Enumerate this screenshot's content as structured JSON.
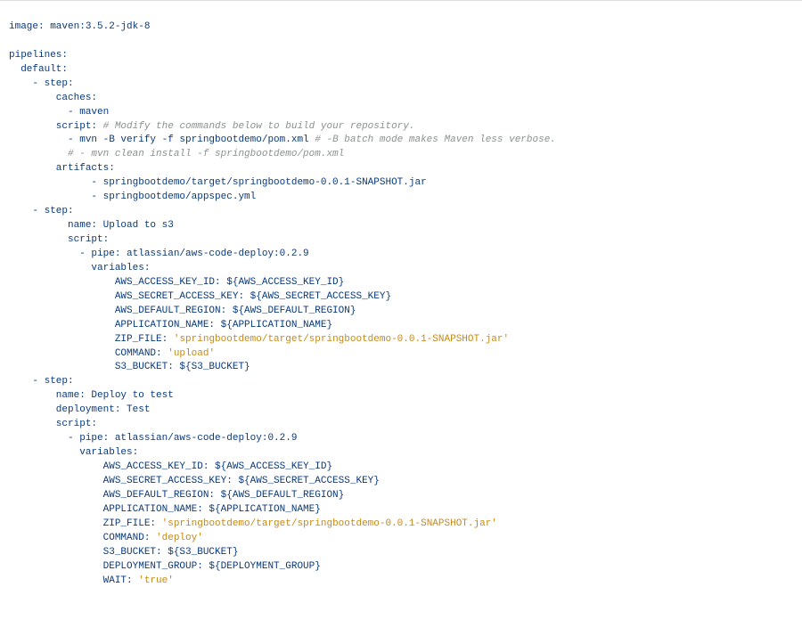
{
  "l1": "image: maven:3.5.2-jdk-8",
  "l2": "",
  "l3": "pipelines:",
  "l4": "  default:",
  "l5": "    - step:",
  "l6": "        caches:",
  "l7": "          - maven",
  "l8k": "        script: ",
  "l8c": "# Modify the commands below to build your repository.",
  "l9k": "          - mvn -B verify -f springbootdemo/pom.xml ",
  "l9c": "# -B batch mode makes Maven less verbose.",
  "l10": "          # - mvn clean install -f springbootdemo/pom.xml",
  "l11": "        artifacts:",
  "l12": "              - springbootdemo/target/springbootdemo-0.0.1-SNAPSHOT.jar",
  "l13": "              - springbootdemo/appspec.yml",
  "l14": "    - step:",
  "l15": "          name: Upload to s3",
  "l16": "          script:",
  "l17": "            - pipe: atlassian/aws-code-deploy:0.2.9",
  "l18": "              variables:",
  "l19": "                  AWS_ACCESS_KEY_ID: ${AWS_ACCESS_KEY_ID}",
  "l20": "                  AWS_SECRET_ACCESS_KEY: ${AWS_SECRET_ACCESS_KEY}",
  "l21": "                  AWS_DEFAULT_REGION: ${AWS_DEFAULT_REGION}",
  "l22": "                  APPLICATION_NAME: ${APPLICATION_NAME}",
  "l23k": "                  ZIP_FILE: ",
  "l23s": "'springbootdemo/target/springbootdemo-0.0.1-SNAPSHOT.jar'",
  "l24k": "                  COMMAND: ",
  "l24s": "'upload'",
  "l25": "                  S3_BUCKET: ${S3_BUCKET}",
  "l26": "    - step:",
  "l27": "        name: Deploy to test",
  "l28": "        deployment: Test",
  "l29": "        script:",
  "l30": "          - pipe: atlassian/aws-code-deploy:0.2.9",
  "l31": "            variables:",
  "l32": "                AWS_ACCESS_KEY_ID: ${AWS_ACCESS_KEY_ID}",
  "l33": "                AWS_SECRET_ACCESS_KEY: ${AWS_SECRET_ACCESS_KEY}",
  "l34": "                AWS_DEFAULT_REGION: ${AWS_DEFAULT_REGION}",
  "l35": "                APPLICATION_NAME: ${APPLICATION_NAME}",
  "l36k": "                ZIP_FILE: ",
  "l36s": "'springbootdemo/target/springbootdemo-0.0.1-SNAPSHOT.jar'",
  "l37k": "                COMMAND: ",
  "l37s": "'deploy'",
  "l38": "                S3_BUCKET: ${S3_BUCKET}",
  "l39": "                DEPLOYMENT_GROUP: ${DEPLOYMENT_GROUP}",
  "l40k": "                WAIT: ",
  "l40s": "'true'"
}
